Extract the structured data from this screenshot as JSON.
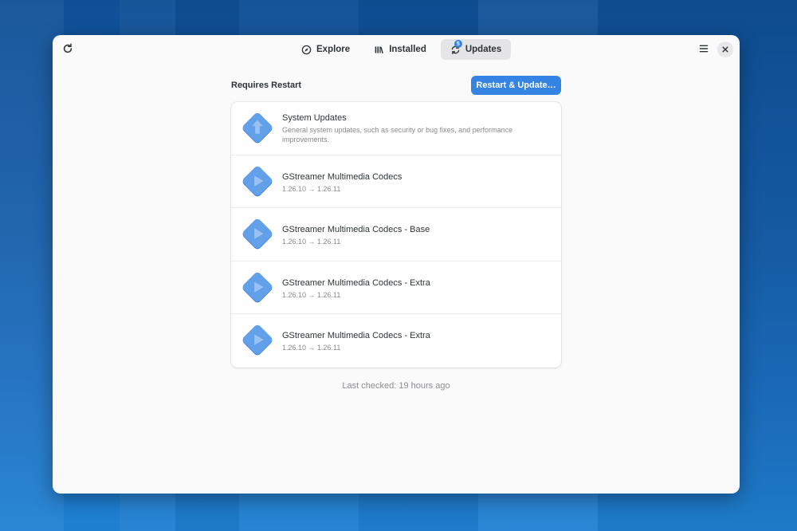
{
  "toolbar": {
    "refresh_icon": "refresh-icon",
    "menu_icon": "hamburger-menu-icon",
    "close_icon": "close-icon"
  },
  "tabs": [
    {
      "label": "Explore",
      "icon": "compass-icon",
      "active": false
    },
    {
      "label": "Installed",
      "icon": "library-icon",
      "active": false
    },
    {
      "label": "Updates",
      "icon": "updates-icon",
      "active": true,
      "badge": "5"
    }
  ],
  "section": {
    "title": "Requires Restart",
    "button_label": "Restart & Update…"
  },
  "updates": [
    {
      "name": "System Updates",
      "detail": "General system updates, such as security or bug fixes, and performance improvements.",
      "icon": "system-update-icon"
    },
    {
      "name": "GStreamer Multimedia Codecs",
      "detail": "1.26.10 → 1.26.11",
      "icon": "codec-icon"
    },
    {
      "name": "GStreamer Multimedia Codecs - Base",
      "detail": "1.26.10 → 1.26.11",
      "icon": "codec-icon"
    },
    {
      "name": "GStreamer Multimedia Codecs - Extra",
      "detail": "1.26.10 → 1.26.11",
      "icon": "codec-icon"
    },
    {
      "name": "GStreamer Multimedia Codecs - Extra",
      "detail": "1.26.10 → 1.26.11",
      "icon": "codec-icon"
    }
  ],
  "footer": {
    "last_checked": "Last checked: 19 hours ago"
  },
  "colors": {
    "accent": "#3584e4",
    "icon_blue": "#62a0ea",
    "window_bg": "#fafafb"
  }
}
